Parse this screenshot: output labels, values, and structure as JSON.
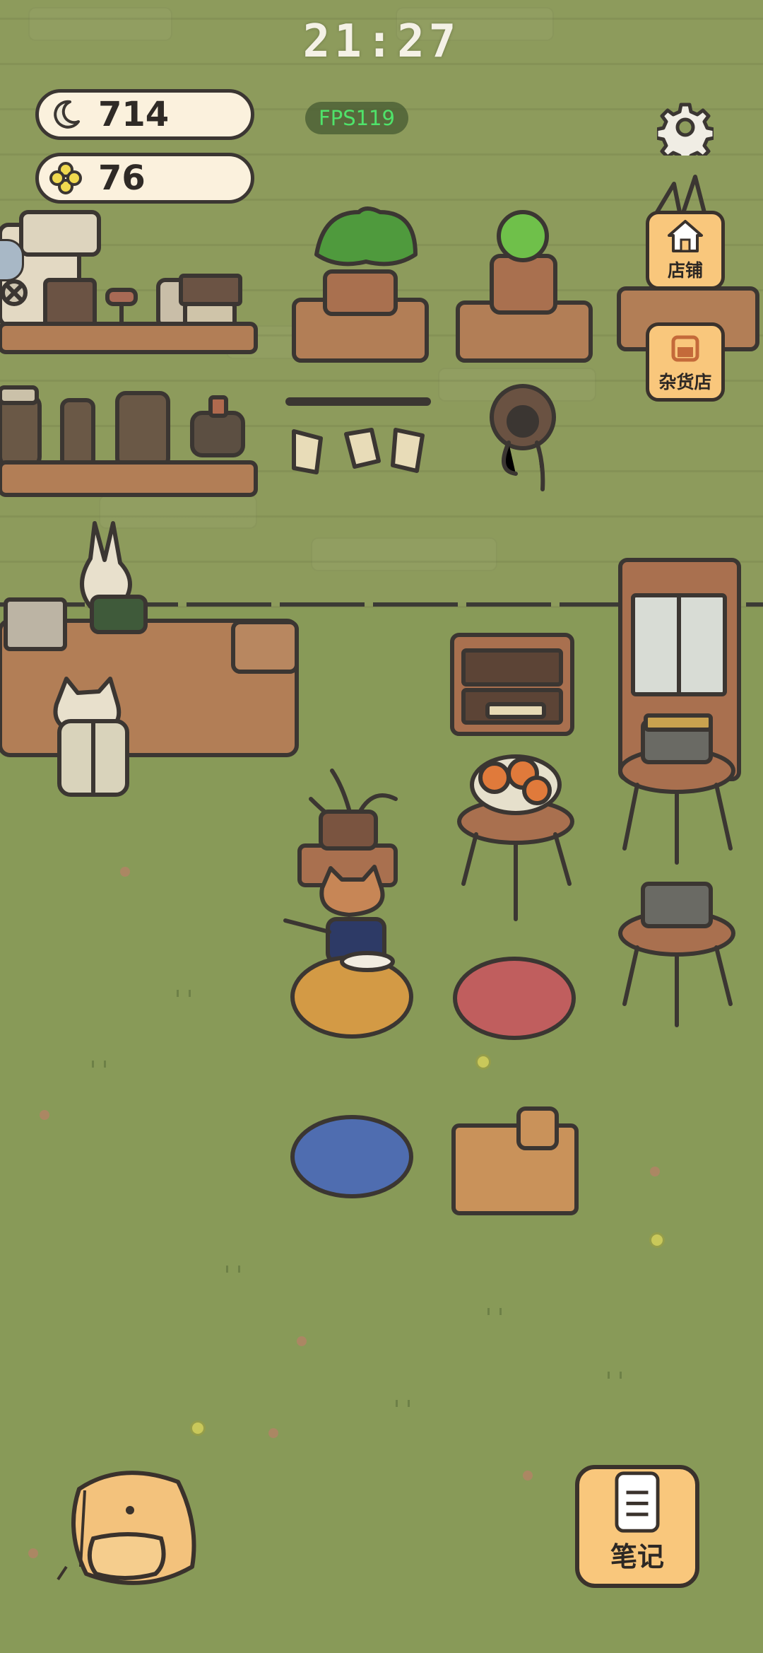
{
  "hud": {
    "time": "21:27",
    "moon_currency": "714",
    "clover_currency": "76",
    "fps": "FPS119"
  },
  "buttons": {
    "shop": "店铺",
    "grocery": "杂货店",
    "notes": "笔记"
  },
  "icons": {
    "moon": "moon-icon",
    "clover": "clover-icon",
    "settings": "gear-icon",
    "shop": "house-icon",
    "grocery": "store-icon",
    "notes": "notebook-icon",
    "bag": "backpack-icon"
  },
  "colors": {
    "wall": "#8d9b5c",
    "floor": "#889a58",
    "button": "#f9c77c",
    "outline": "#3b3632"
  }
}
